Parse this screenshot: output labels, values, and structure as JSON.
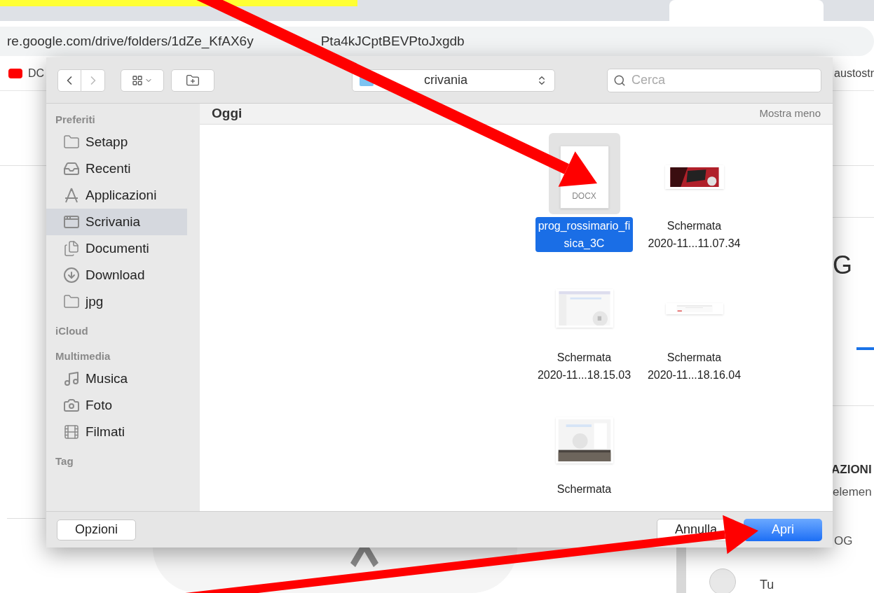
{
  "browser": {
    "url_parts": [
      "re.google.com/drive/folders/1dZe_KfAX6y",
      "Pta4kJCptBEVPtoJxgdb"
    ],
    "bookmarks": [
      "DC",
      "austostr"
    ],
    "page": {
      "heading": "G",
      "section_label": "AZIONI",
      "caption": "elemen",
      "folder_caption": "OG",
      "user_name": "Tu"
    }
  },
  "dialog": {
    "location": "crivania",
    "search": {
      "placeholder": "Cerca"
    },
    "sidebar": [
      {
        "title": "Preferiti",
        "items": [
          {
            "label": "Setapp",
            "kind": "folder",
            "selected": false
          },
          {
            "label": "Recenti",
            "kind": "recent",
            "selected": false
          },
          {
            "label": "Applicazioni",
            "kind": "apps",
            "selected": false
          },
          {
            "label": "Scrivania",
            "kind": "desktop",
            "selected": true
          },
          {
            "label": "Documenti",
            "kind": "documents",
            "selected": false
          },
          {
            "label": "Download",
            "kind": "download",
            "selected": false
          },
          {
            "label": "jpg",
            "kind": "folder",
            "selected": false
          }
        ]
      },
      {
        "title": "iCloud"
      },
      {
        "title": "Multimedia",
        "items": [
          {
            "label": "Musica",
            "kind": "music",
            "selected": false
          },
          {
            "label": "Foto",
            "selected": false
          },
          {
            "label": "Filmati",
            "kind": "movie",
            "selected": false
          }
        ]
      },
      {
        "title": "Tag"
      }
    ],
    "group": {
      "title": "Oggi",
      "toggle": "Mostra meno"
    },
    "files": [
      {
        "kind": "document",
        "badge": "DOCX",
        "lines": [
          "prog_rossimario_fi",
          "sica_3C"
        ],
        "selected": true
      },
      {
        "kind": "banner",
        "lines": [
          "Schermata",
          "2020-11...11.07.34"
        ],
        "selected": false
      },
      {
        "kind": "screenshot",
        "lines": [
          "Schermata",
          "2020-11...18.15.03"
        ],
        "selected": false
      },
      {
        "kind": "strip",
        "lines": [
          "Schermata",
          "2020-11...18.16.04"
        ],
        "selected": false
      },
      {
        "kind": "desktop",
        "lines": [
          "Schermata"
        ],
        "selected": false
      }
    ],
    "buttons": {
      "options": "Opzioni",
      "cancel": "Annulla",
      "open": "Apri"
    }
  }
}
